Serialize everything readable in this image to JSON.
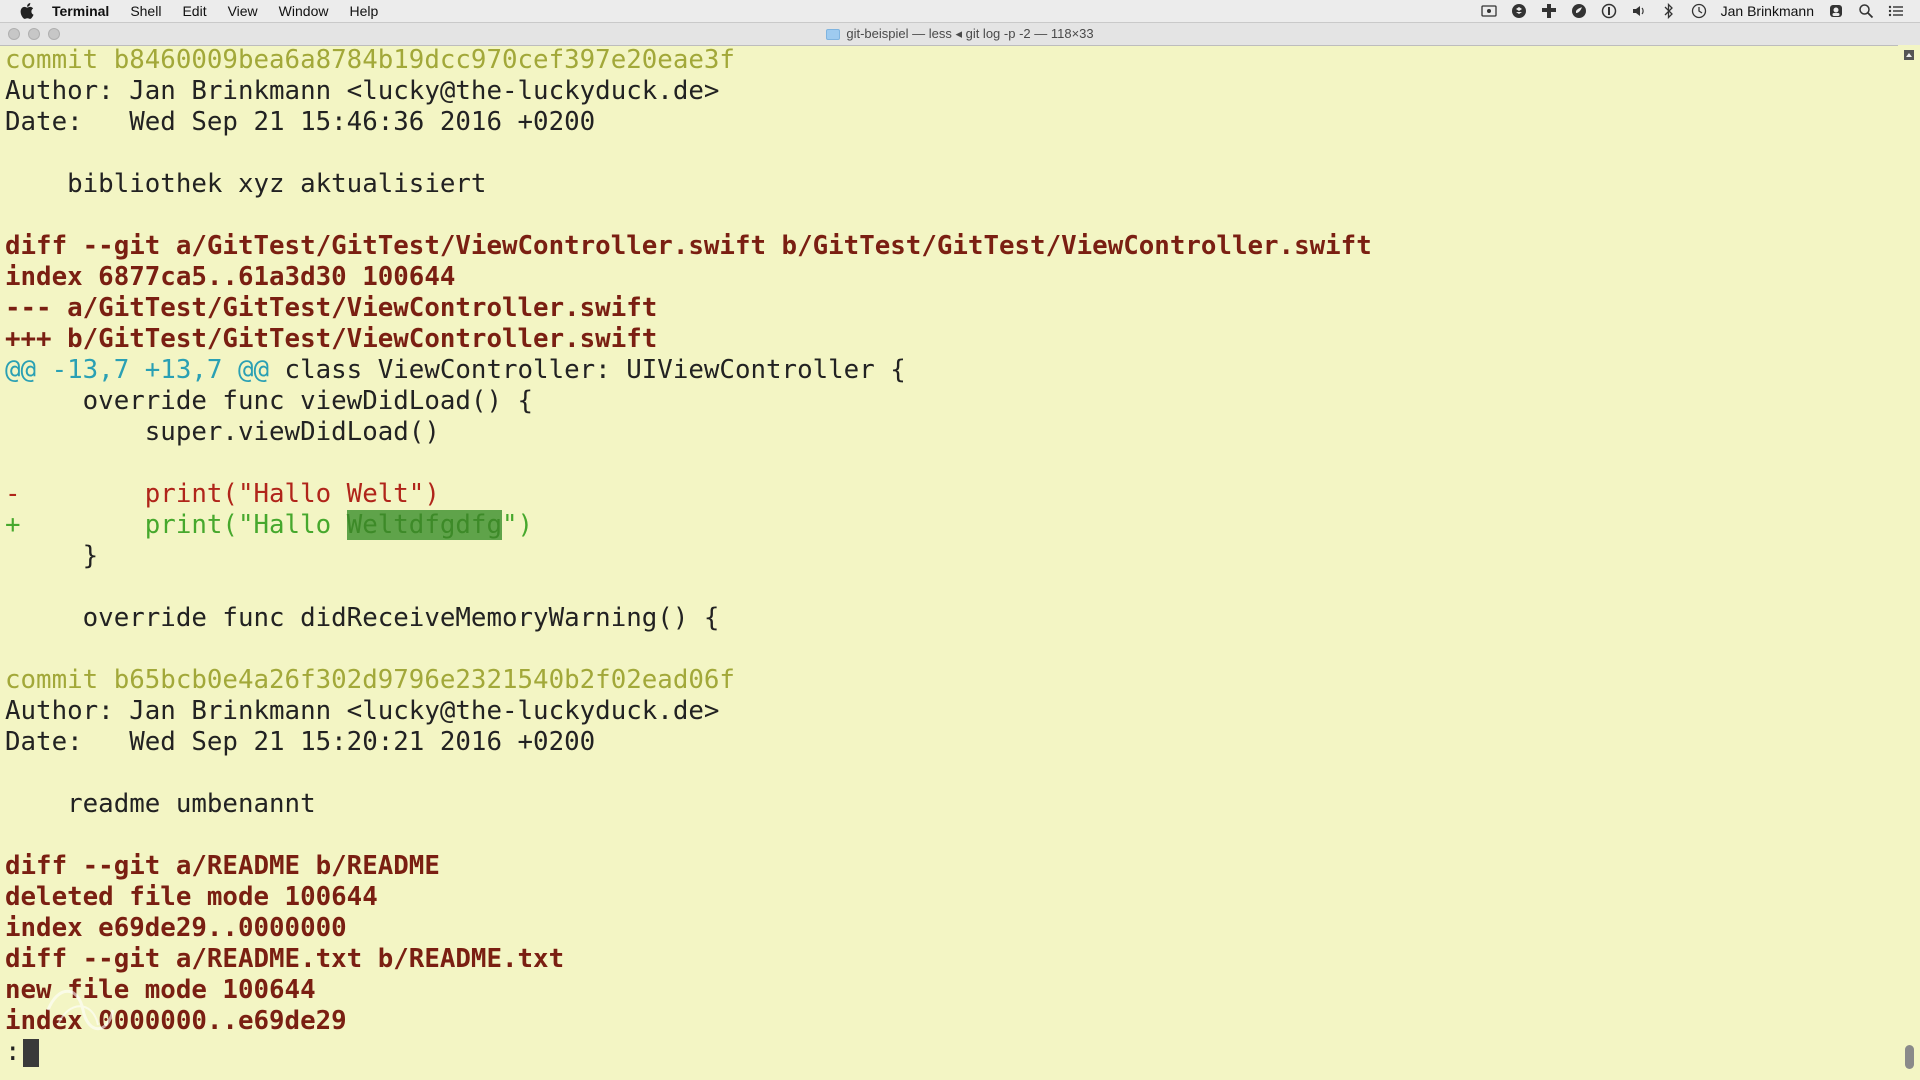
{
  "menubar": {
    "app": "Terminal",
    "items": [
      "Shell",
      "Edit",
      "View",
      "Window",
      "Help"
    ],
    "user": "Jan Brinkmann"
  },
  "window": {
    "title": "git-beispiel — less ◂ git log -p -2 — 118×33"
  },
  "terminal": {
    "lines": [
      {
        "kind": "commit",
        "text": "commit b8460009bea6a8784b19dcc970cef397e20eae3f"
      },
      {
        "kind": "meta",
        "text": "Author: Jan Brinkmann <lucky@the-luckyduck.de>"
      },
      {
        "kind": "meta",
        "text": "Date:   Wed Sep 21 15:46:36 2016 +0200"
      },
      {
        "kind": "blank",
        "text": ""
      },
      {
        "kind": "meta",
        "text": "    bibliothek xyz aktualisiert"
      },
      {
        "kind": "blank",
        "text": ""
      },
      {
        "kind": "diffhdr",
        "text": "diff --git a/GitTest/GitTest/ViewController.swift b/GitTest/GitTest/ViewController.swift"
      },
      {
        "kind": "diffhdr",
        "text": "index 6877ca5..61a3d30 100644"
      },
      {
        "kind": "diffhdr",
        "text": "--- a/GitTest/GitTest/ViewController.swift"
      },
      {
        "kind": "diffhdr",
        "text": "+++ b/GitTest/GitTest/ViewController.swift"
      },
      {
        "kind": "hunk",
        "text": "@@ -13,7 +13,7 @@",
        "rest": " class ViewController: UIViewController {"
      },
      {
        "kind": "ctx",
        "text": "     override func viewDidLoad() {"
      },
      {
        "kind": "ctx",
        "text": "         super.viewDidLoad()"
      },
      {
        "kind": "blank",
        "text": ""
      },
      {
        "kind": "del",
        "text": "-        print(\"Hallo Welt\")"
      },
      {
        "kind": "add",
        "text": "+        print(\"Hallo ",
        "highlight": "Weltdfgdfg",
        "rest": "\")"
      },
      {
        "kind": "ctx",
        "text": "     }"
      },
      {
        "kind": "blank",
        "text": ""
      },
      {
        "kind": "ctx",
        "text": "     override func didReceiveMemoryWarning() {"
      },
      {
        "kind": "blank",
        "text": ""
      },
      {
        "kind": "commit",
        "text": "commit b65bcb0e4a26f302d9796e2321540b2f02ead06f"
      },
      {
        "kind": "meta",
        "text": "Author: Jan Brinkmann <lucky@the-luckyduck.de>"
      },
      {
        "kind": "meta",
        "text": "Date:   Wed Sep 21 15:20:21 2016 +0200"
      },
      {
        "kind": "blank",
        "text": ""
      },
      {
        "kind": "meta",
        "text": "    readme umbenannt"
      },
      {
        "kind": "blank",
        "text": ""
      },
      {
        "kind": "diffhdr",
        "text": "diff --git a/README b/README"
      },
      {
        "kind": "diffhdr",
        "text": "deleted file mode 100644"
      },
      {
        "kind": "diffhdr",
        "text": "index e69de29..0000000"
      },
      {
        "kind": "diffhdr",
        "text": "diff --git a/README.txt b/README.txt"
      },
      {
        "kind": "diffhdr",
        "text": "new file mode 100644"
      },
      {
        "kind": "diffhdr",
        "text": "index 0000000..e69de29"
      }
    ],
    "prompt": ":"
  },
  "colors": {
    "background": "#f3f5c4",
    "commit": "#a2a839",
    "diff_header": "#7a1f12",
    "hunk": "#2aa0b4",
    "deleted": "#b0251a",
    "added": "#46a82d"
  }
}
